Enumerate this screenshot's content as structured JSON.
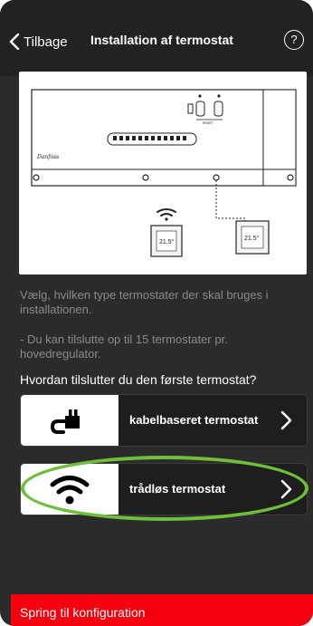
{
  "header": {
    "back_label": "Tilbage",
    "title": "Installation af termostat",
    "help_glyph": "?"
  },
  "illustration": {
    "controller_brand": "Danfoss",
    "controller_button_label": "RESET",
    "thermostat_display": "21.5°",
    "thermostat_display_2": "21.5°",
    "icons": [
      "wifi-icon",
      "thermostat-icon",
      "controller-icon"
    ]
  },
  "info": {
    "line1": "Vælg, hvilken type termostater der skal bruges i installationen.",
    "line2": "- Du kan tilslutte op til 15 termostater pr. hovedregulator."
  },
  "question": "Hvordan tilslutter du den første termostat?",
  "options": [
    {
      "label": "kabelbaseret termostat",
      "icon": "cable-plug-icon"
    },
    {
      "label": "trådløs termostat",
      "icon": "wifi-icon"
    }
  ],
  "bottom_button": "Spring til konfiguration",
  "colors": {
    "accent": "#f5000f",
    "highlight": "#6fbf3a",
    "background": "#2b2b2b"
  }
}
